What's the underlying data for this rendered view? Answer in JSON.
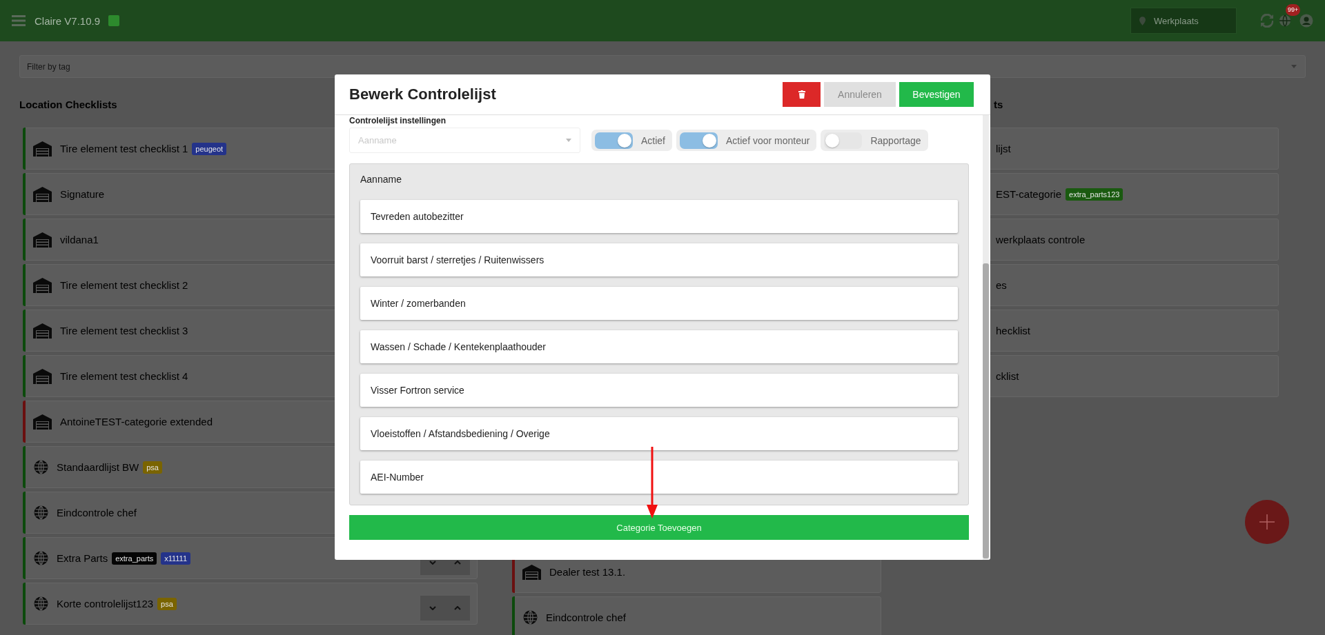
{
  "topbar": {
    "title": "Claire V7.10.9",
    "location_placeholder": "Werkplaats",
    "notification_count": "99+"
  },
  "filter": {
    "placeholder": "Filter by tag"
  },
  "left_column": {
    "title": "Location Checklists",
    "rows": [
      {
        "label": "Tire element test checklist 1",
        "kind": "location",
        "color": "#0c4a0c",
        "tags": [
          {
            "label": "peugeot",
            "color": "#24338a"
          }
        ]
      },
      {
        "label": "Signature",
        "kind": "location",
        "color": "#0c4a0c",
        "tags": []
      },
      {
        "label": "vildana1",
        "kind": "location",
        "color": "#0c4a0c",
        "tags": []
      },
      {
        "label": "Tire element test checklist 2",
        "kind": "location",
        "color": "#0c4a0c",
        "tags": []
      },
      {
        "label": "Tire element test checklist 3",
        "kind": "location",
        "color": "#0c4a0c",
        "tags": []
      },
      {
        "label": "Tire element test checklist 4",
        "kind": "location",
        "color": "#0c4a0c",
        "tags": []
      },
      {
        "label": "AntoineTEST-categorie extended",
        "kind": "location",
        "color": "#6a1010",
        "tags": []
      },
      {
        "label": "Standaardlijst BW",
        "kind": "global",
        "color": "#0c4a0c",
        "tags": [
          {
            "label": "psa",
            "color": "#7a6400"
          }
        ]
      },
      {
        "label": "Eindcontrole chef",
        "kind": "global",
        "color": "#0c4a0c",
        "tags": []
      },
      {
        "label": "Extra Parts",
        "kind": "global",
        "color": "#0c4a0c",
        "tags": [
          {
            "label": "extra_parts",
            "color": "#050505"
          },
          {
            "label": "x11111",
            "color": "#24338a"
          }
        ],
        "order_buttons": true
      },
      {
        "label": "Korte controlelijst123",
        "kind": "global",
        "color": "#0c4a0c",
        "tags": [
          {
            "label": "psa",
            "color": "#7a6400"
          }
        ],
        "order_buttons": true
      }
    ]
  },
  "middle_column": {
    "rows": [
      {
        "label": "Dealer test 13.1.",
        "kind": "location",
        "color": "#6a1010"
      },
      {
        "label": "Eindcontrole chef",
        "kind": "global",
        "color": "#0c4a0c"
      }
    ]
  },
  "right_column": {
    "title": "ts",
    "rows": [
      {
        "label": "lijst",
        "tags": []
      },
      {
        "label": "EST-categorie",
        "tags": [
          {
            "label": "extra_parts123",
            "color": "#1a5a10"
          }
        ]
      },
      {
        "label": "werkplaats controle",
        "tags": []
      },
      {
        "label": "es",
        "tags": []
      },
      {
        "label": "hecklist",
        "tags": []
      },
      {
        "label": "cklist",
        "tags": []
      }
    ]
  },
  "modal": {
    "title": "Bewerk Controlelijst",
    "buttons": [
      {
        "kind": "delete"
      },
      {
        "kind": "cancel",
        "label": "Annuleren"
      },
      {
        "kind": "confirm",
        "label": "Bevestigen"
      }
    ],
    "settings_heading": "Controlelijst instellingen",
    "category_select": {
      "placeholder": "Aanname"
    },
    "toggles": [
      {
        "label": "Actief",
        "on": true
      },
      {
        "label": "Actief voor monteur",
        "on": true
      },
      {
        "label": "Rapportage",
        "on": false
      }
    ],
    "panel": {
      "title": "Aanname",
      "items": [
        "Tevreden autobezitter",
        "Voorruit barst / sterretjes / Ruitenwissers",
        "Winter / zomerbanden",
        "Wassen / Schade / Kentekenplaathouder",
        "Visser Fortron service",
        "Vloeistoffen / Afstandsbediening / Overige",
        "AEI-Number"
      ]
    },
    "add_button": "Categorie Toevoegen"
  }
}
